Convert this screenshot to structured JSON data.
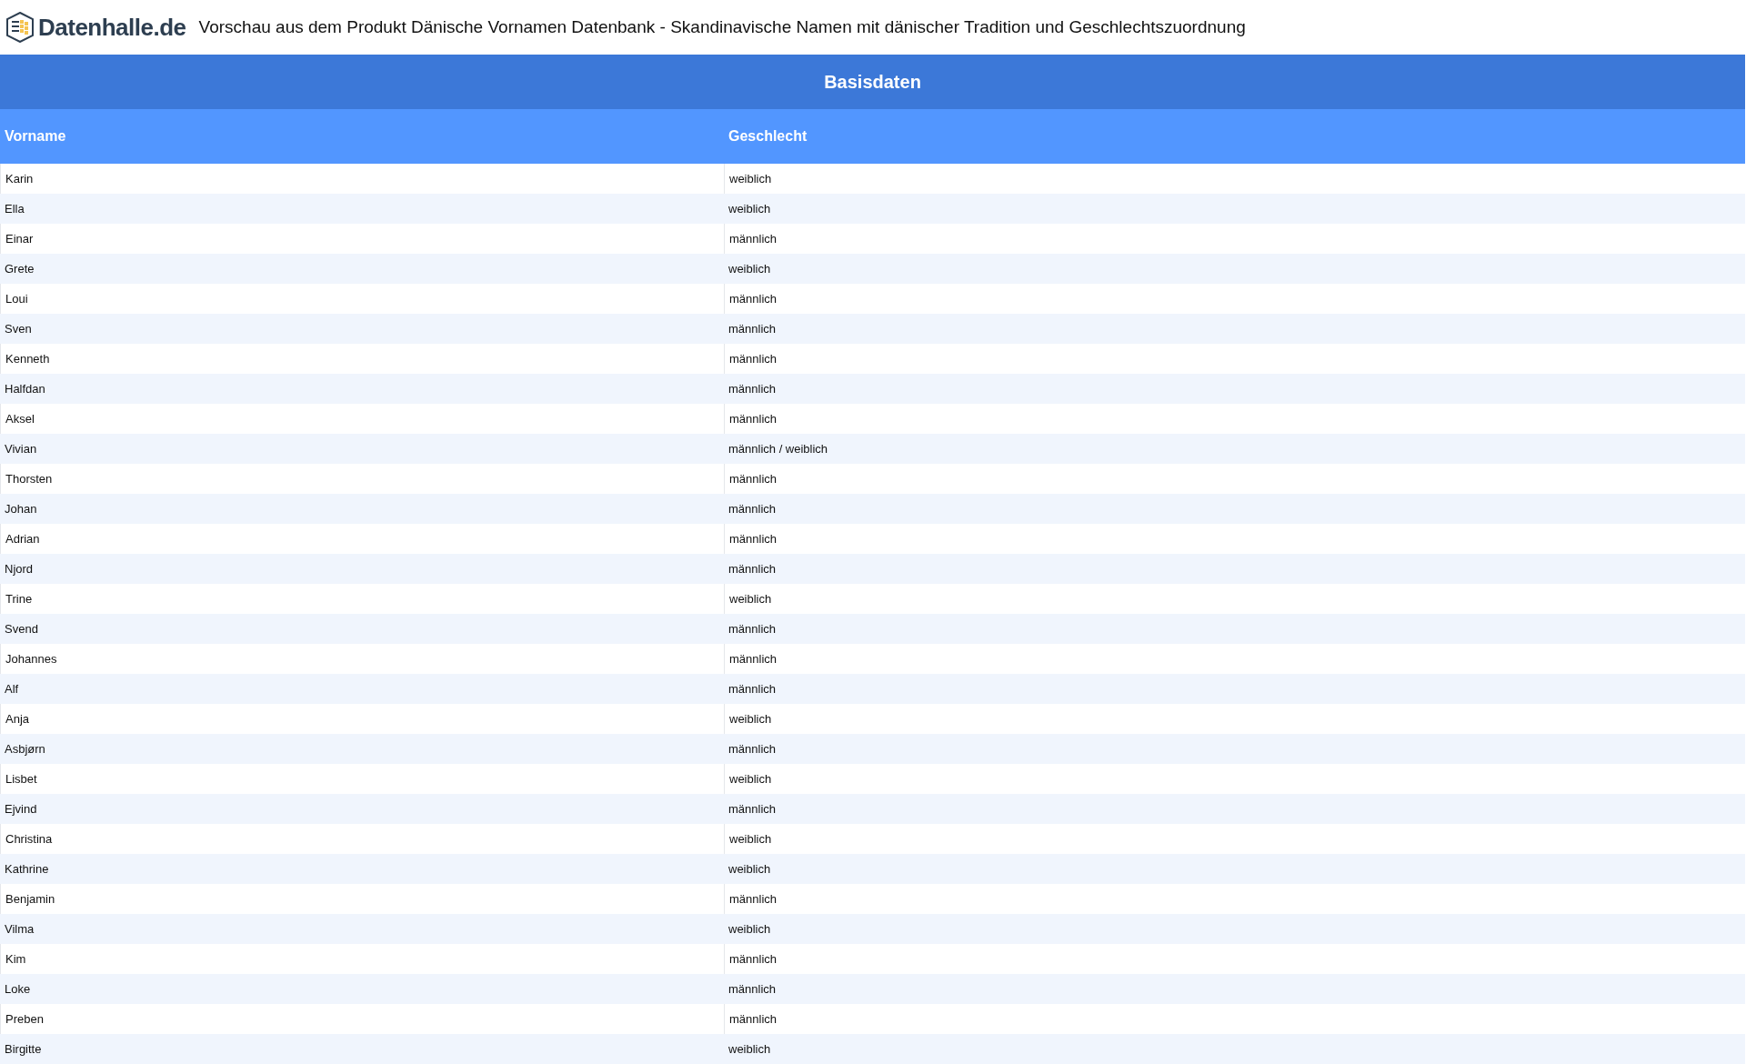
{
  "header": {
    "logo": "Datenhalle.de",
    "title": "Vorschau aus dem Produkt Dänische Vornamen Datenbank - Skandinavische Namen mit dänischer Tradition und Geschlechtszuordnung"
  },
  "table": {
    "caption": "Basisdaten",
    "columns": [
      "Vorname",
      "Geschlecht"
    ],
    "rows": [
      [
        "Karin",
        "weiblich"
      ],
      [
        "Ella",
        "weiblich"
      ],
      [
        "Einar",
        "männlich"
      ],
      [
        "Grete",
        "weiblich"
      ],
      [
        "Loui",
        "männlich"
      ],
      [
        "Sven",
        "männlich"
      ],
      [
        "Kenneth",
        "männlich"
      ],
      [
        "Halfdan",
        "männlich"
      ],
      [
        "Aksel",
        "männlich"
      ],
      [
        "Vivian",
        "männlich / weiblich"
      ],
      [
        "Thorsten",
        "männlich"
      ],
      [
        "Johan",
        "männlich"
      ],
      [
        "Adrian",
        "männlich"
      ],
      [
        "Njord",
        "männlich"
      ],
      [
        "Trine",
        "weiblich"
      ],
      [
        "Svend",
        "männlich"
      ],
      [
        "Johannes",
        "männlich"
      ],
      [
        "Alf",
        "männlich"
      ],
      [
        "Anja",
        "weiblich"
      ],
      [
        "Asbjørn",
        "männlich"
      ],
      [
        "Lisbet",
        "weiblich"
      ],
      [
        "Ejvind",
        "männlich"
      ],
      [
        "Christina",
        "weiblich"
      ],
      [
        "Kathrine",
        "weiblich"
      ],
      [
        "Benjamin",
        "männlich"
      ],
      [
        "Vilma",
        "weiblich"
      ],
      [
        "Kim",
        "männlich"
      ],
      [
        "Loke",
        "männlich"
      ],
      [
        "Preben",
        "männlich"
      ],
      [
        "Birgitte",
        "weiblich"
      ]
    ]
  }
}
